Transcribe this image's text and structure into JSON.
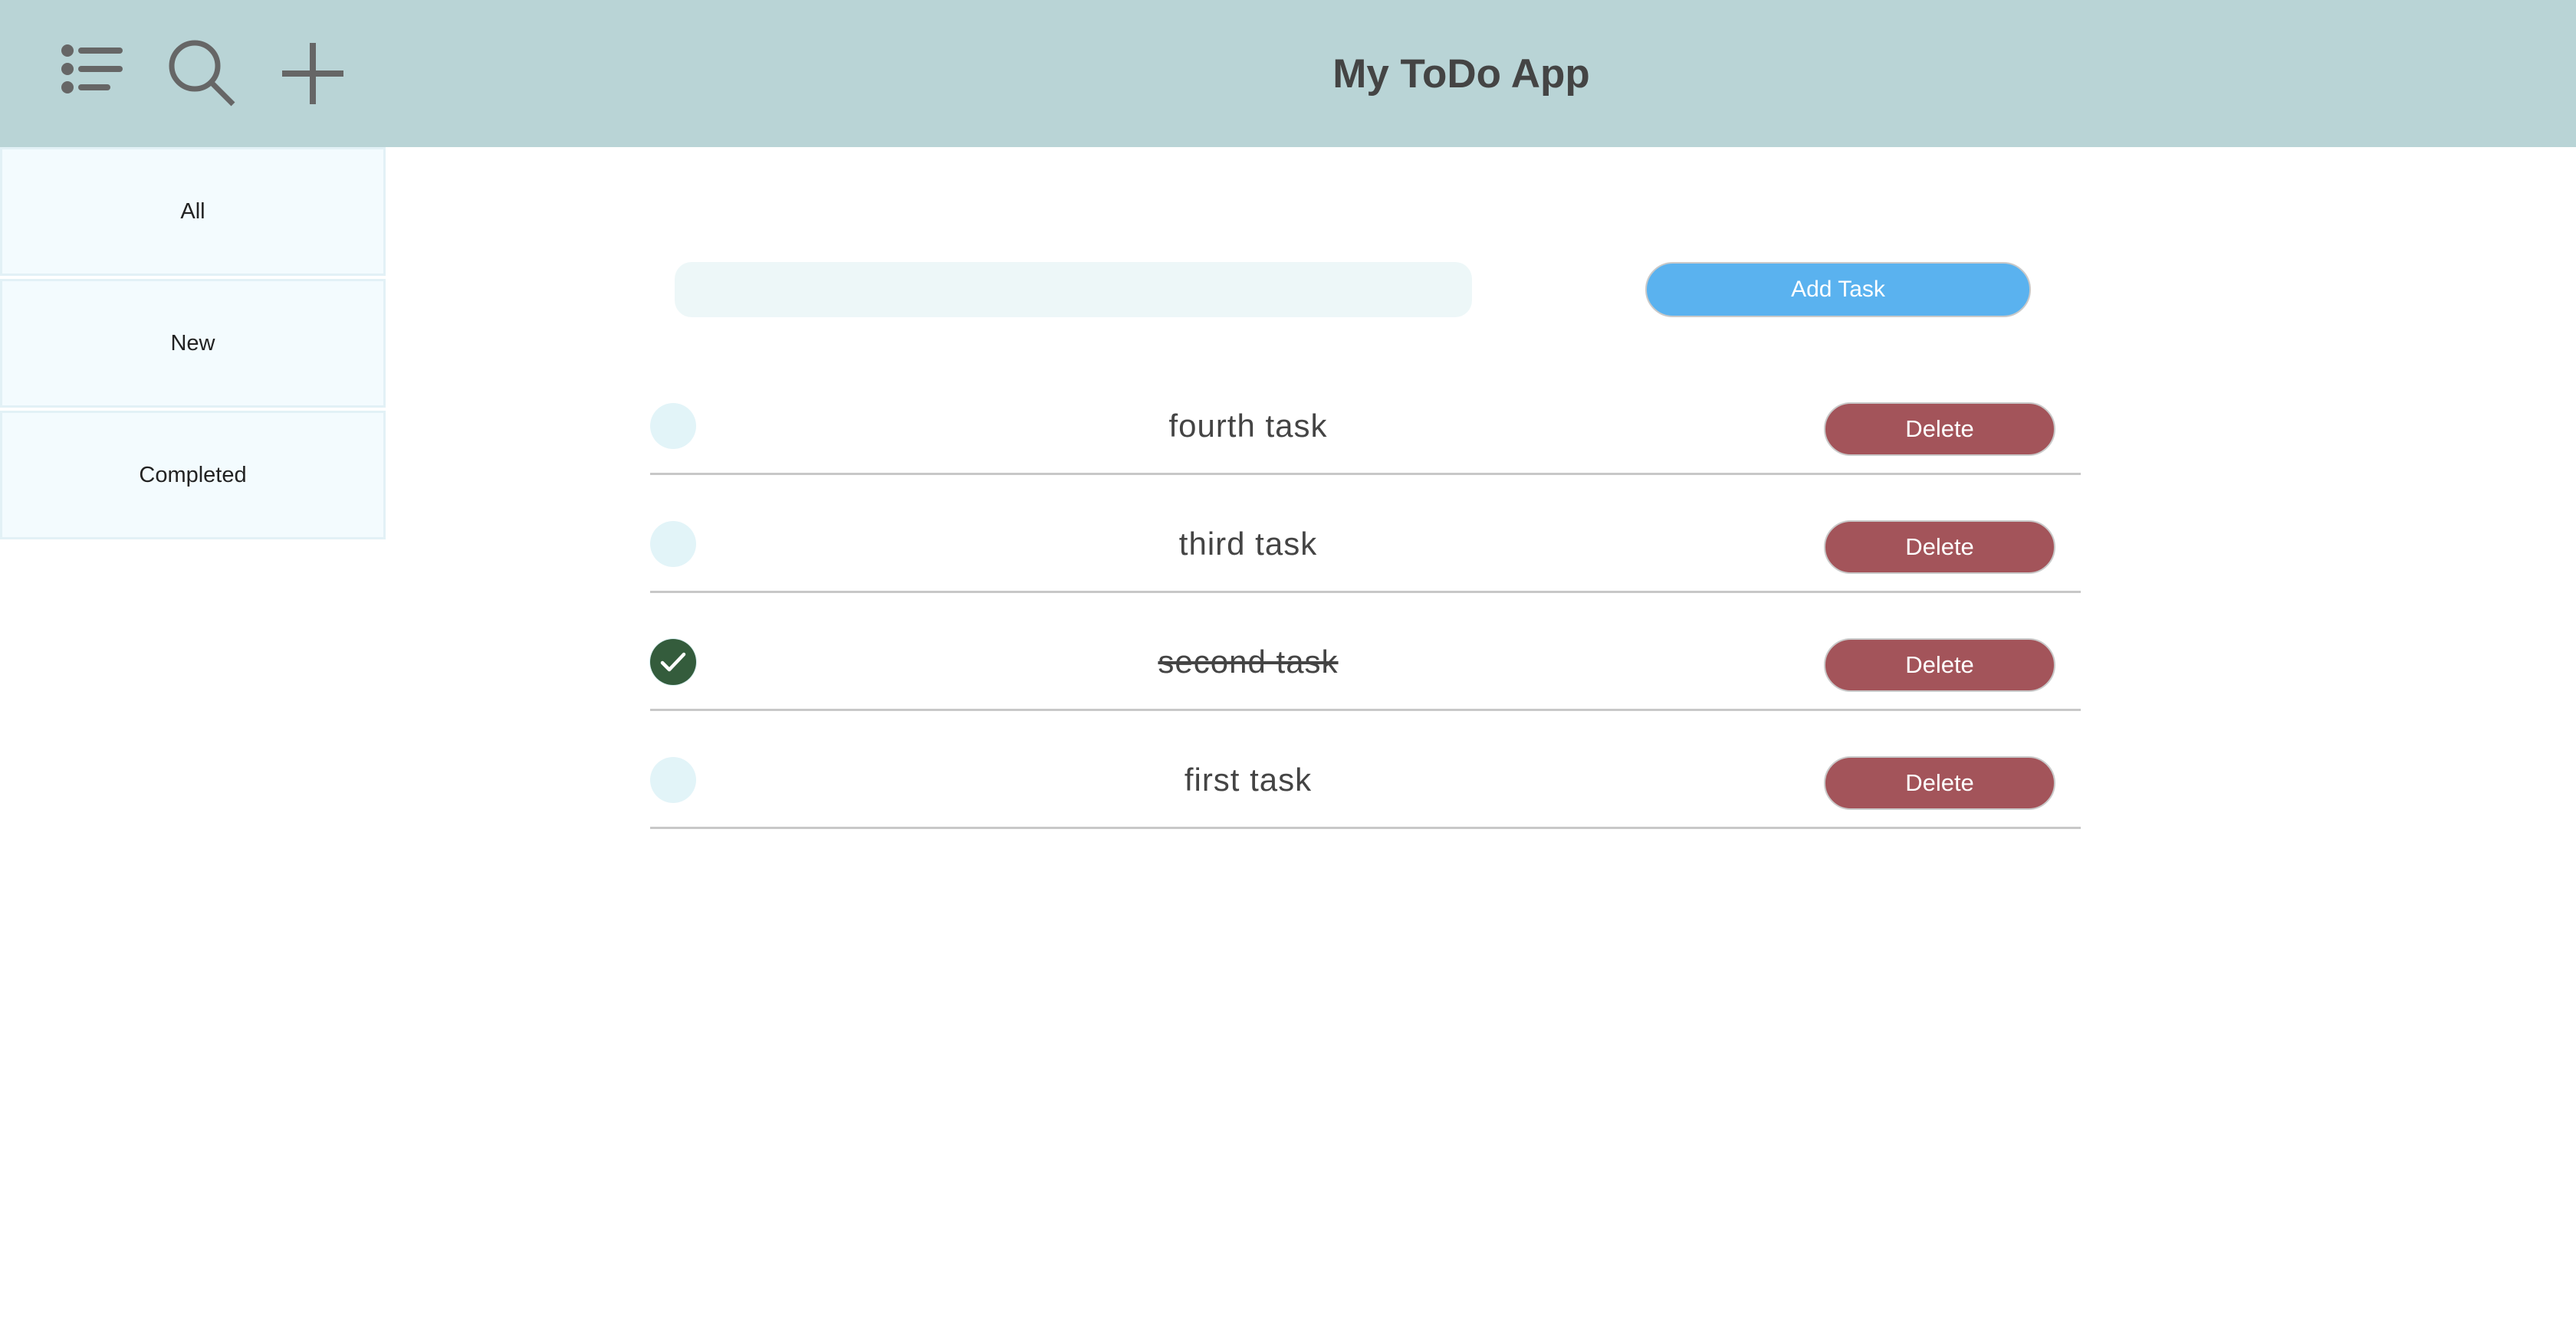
{
  "header": {
    "title": "My ToDo App",
    "icons": [
      "list-icon",
      "search-icon",
      "plus-icon"
    ]
  },
  "sidebar": {
    "items": [
      {
        "label": "All"
      },
      {
        "label": "New"
      },
      {
        "label": "Completed"
      }
    ]
  },
  "new_task": {
    "value": "",
    "placeholder": "",
    "add_label": "Add Task"
  },
  "tasks": [
    {
      "text": "fourth task",
      "completed": false,
      "delete_label": "Delete"
    },
    {
      "text": "third task",
      "completed": false,
      "delete_label": "Delete"
    },
    {
      "text": "second task",
      "completed": true,
      "delete_label": "Delete"
    },
    {
      "text": "first task",
      "completed": false,
      "delete_label": "Delete"
    }
  ],
  "colors": {
    "header_bg": "#b9d4d6",
    "add_button": "#5ab2ef",
    "delete_button": "#a3545a",
    "completed_check": "#345c3c"
  }
}
